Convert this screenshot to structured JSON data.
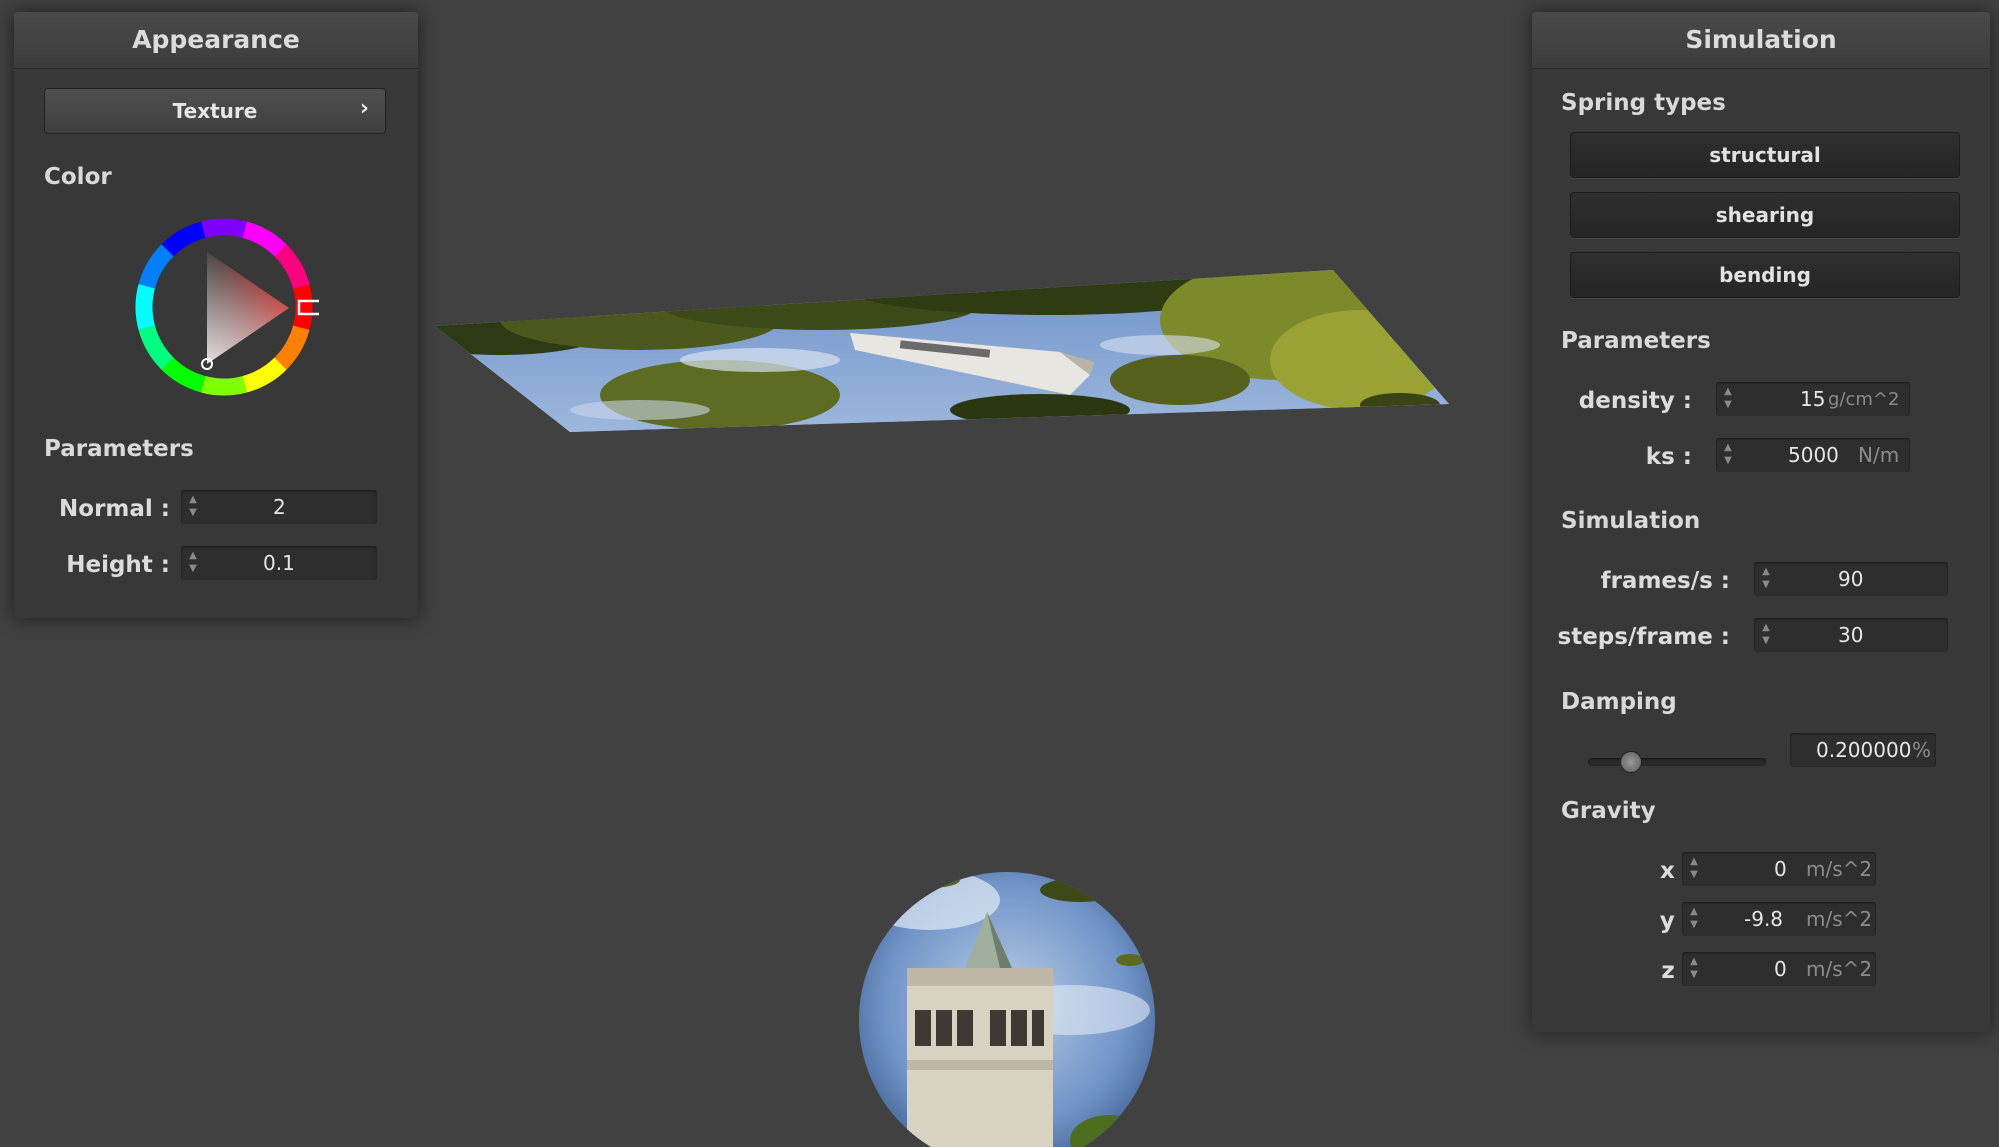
{
  "appearance": {
    "title": "Appearance",
    "texture_button": "Texture",
    "texture_chevron": "›",
    "color_label": "Color",
    "params_label": "Parameters",
    "normal_label": "Normal :",
    "normal_value": "2",
    "height_label": "Height :",
    "height_value": "0.1",
    "selected_color": "#8b1a1a"
  },
  "simulation": {
    "title": "Simulation",
    "spring_types_label": "Spring types",
    "spring_types": [
      "structural",
      "shearing",
      "bending"
    ],
    "params_label": "Parameters",
    "density_label": "density :",
    "density_value": "15",
    "density_unit": "g/cm^2",
    "ks_label": "ks :",
    "ks_value": "5000",
    "ks_unit": "N/m",
    "sim_label": "Simulation",
    "fps_label": "frames/s :",
    "fps_value": "90",
    "steps_label": "steps/frame :",
    "steps_value": "30",
    "damping_label": "Damping",
    "damping_value": "0.200000",
    "damping_unit": "%",
    "damping_slider_level": 0.2,
    "gravity_label": "Gravity",
    "gx_label": "x :",
    "gx_value": "0",
    "gy_label": "y :",
    "gy_value": "-9.8",
    "gz_label": "z :",
    "gz_value": "0",
    "gravity_unit": "m/s^2"
  },
  "icons": {
    "spinner": "up-down-arrows-icon",
    "chevron": "chevron-right-icon"
  }
}
